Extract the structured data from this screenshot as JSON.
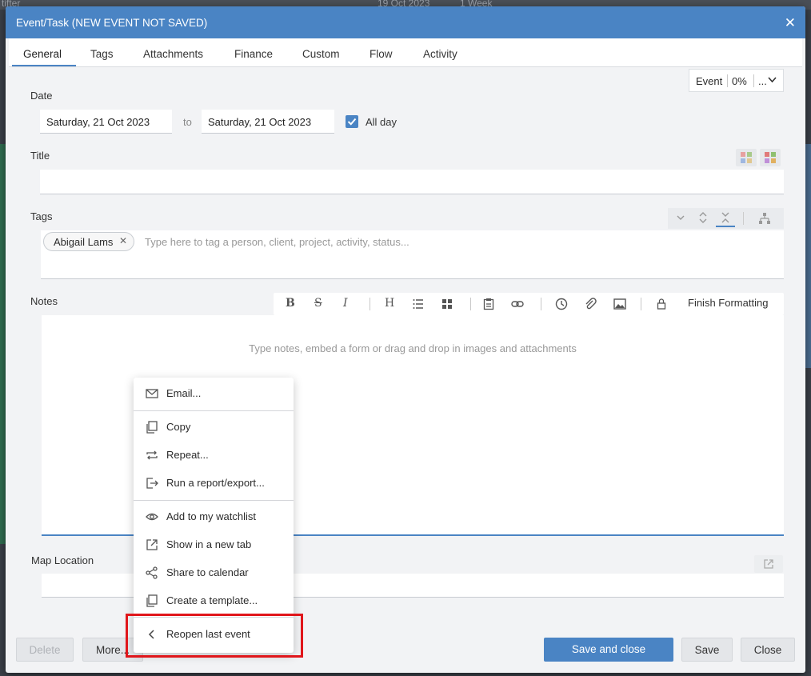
{
  "background": {
    "crumb_left": "tifter",
    "crumb_date": "19 Oct 2023",
    "crumb_range": "1 Week"
  },
  "dialog": {
    "title": "Event/Task (NEW EVENT NOT SAVED)"
  },
  "tabs": [
    {
      "label": "General"
    },
    {
      "label": "Tags"
    },
    {
      "label": "Attachments"
    },
    {
      "label": "Finance"
    },
    {
      "label": "Custom"
    },
    {
      "label": "Flow"
    },
    {
      "label": "Activity"
    }
  ],
  "type_box": {
    "type": "Event",
    "progress": "0%",
    "more": "..."
  },
  "date": {
    "label": "Date",
    "start": "Saturday, 21 Oct 2023",
    "to_label": "to",
    "end": "Saturday, 21 Oct 2023",
    "all_day_label": "All day",
    "all_day_checked": true
  },
  "title_field": {
    "label": "Title",
    "value": ""
  },
  "tags_field": {
    "label": "Tags",
    "chips": [
      "Abigail Lams"
    ],
    "placeholder": "Type here to tag a person, client, project, activity, status..."
  },
  "notes": {
    "label": "Notes",
    "placeholder": "Type notes, embed a form or drag and drop in images and attachments",
    "finish_formatting": "Finish Formatting",
    "toolbar_icons": [
      "bold-icon",
      "strikethrough-icon",
      "italic-icon",
      "heading-icon",
      "list-icon",
      "table-icon",
      "clipboard-icon",
      "link-icon",
      "clock-icon",
      "attachment-icon",
      "image-icon",
      "lock-icon"
    ]
  },
  "map": {
    "label": "Map Location",
    "value": ""
  },
  "footer": {
    "delete": "Delete",
    "more": "More...",
    "save_close": "Save and close",
    "save": "Save",
    "close": "Close"
  },
  "menu": {
    "items": [
      {
        "label": "Email...",
        "icon": "mail-icon"
      },
      {
        "label": "Copy",
        "icon": "copy-icon"
      },
      {
        "label": "Repeat...",
        "icon": "repeat-icon"
      },
      {
        "label": "Run a report/export...",
        "icon": "export-icon"
      },
      {
        "label": "Add to my watchlist",
        "icon": "eye-icon"
      },
      {
        "label": "Show in a new tab",
        "icon": "external-link-icon"
      },
      {
        "label": "Share to calendar",
        "icon": "share-icon"
      },
      {
        "label": "Create a template...",
        "icon": "template-icon"
      },
      {
        "label": "Reopen last event",
        "icon": "chevron-left-icon"
      }
    ]
  },
  "colors": {
    "accent": "#4a84c4",
    "highlight": "#e0161b"
  }
}
